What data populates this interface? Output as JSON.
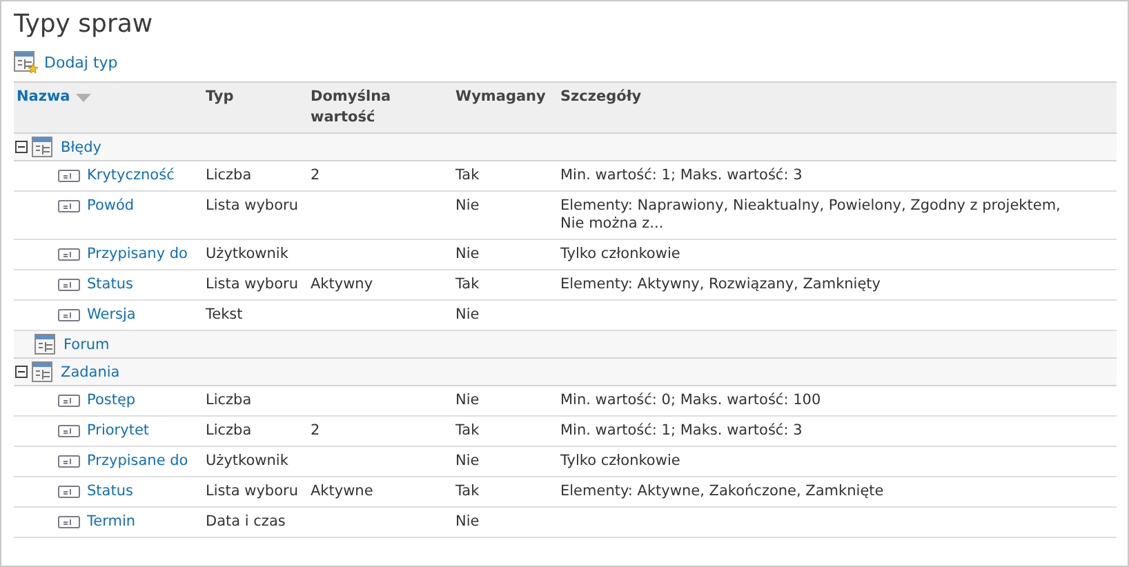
{
  "title": "Typy spraw",
  "toolbar": {
    "add_label": "Dodaj typ"
  },
  "columns": [
    {
      "label": "Nazwa",
      "sorted": true
    },
    {
      "label": "Typ",
      "sorted": false
    },
    {
      "label": "Domyślna wartość",
      "sorted": false
    },
    {
      "label": "Wymagany",
      "sorted": false
    },
    {
      "label": "Szczegóły",
      "sorted": false
    }
  ],
  "groups": [
    {
      "name": "Błędy",
      "expanded": true,
      "children": [
        {
          "name": "Krytyczność",
          "type": "Liczba",
          "default": "2",
          "required": "Tak",
          "details": "Min. wartość: 1; Maks. wartość: 3"
        },
        {
          "name": "Powód",
          "type": "Lista wyboru",
          "required": "Nie",
          "details": "Elementy: Naprawiony, Nieaktualny, Powielony, Zgodny z projektem, Nie można z..."
        },
        {
          "name": "Przypisany do",
          "type": "Użytkownik",
          "required": "Nie",
          "details": "Tylko członkowie"
        },
        {
          "name": "Status",
          "type": "Lista wyboru",
          "default": "Aktywny",
          "required": "Tak",
          "details": "Elementy: Aktywny, Rozwiązany, Zamknięty"
        },
        {
          "name": "Wersja",
          "type": "Tekst",
          "required": "Nie"
        }
      ]
    },
    {
      "name": "Forum"
    },
    {
      "name": "Zadania",
      "expanded": true,
      "children": [
        {
          "name": "Postęp",
          "type": "Liczba",
          "required": "Nie",
          "details": "Min. wartość: 0; Maks. wartość: 100"
        },
        {
          "name": "Priorytet",
          "type": "Liczba",
          "default": "2",
          "required": "Tak",
          "details": "Min. wartość: 1; Maks. wartość: 3"
        },
        {
          "name": "Przypisane do",
          "type": "Użytkownik",
          "required": "Nie",
          "details": "Tylko członkowie"
        },
        {
          "name": "Status",
          "type": "Lista wyboru",
          "default": "Aktywne",
          "required": "Tak",
          "details": "Elementy: Aktywne, Zakończone, Zamknięte"
        },
        {
          "name": "Termin",
          "type": "Data i czas",
          "required": "Nie"
        }
      ]
    }
  ]
}
